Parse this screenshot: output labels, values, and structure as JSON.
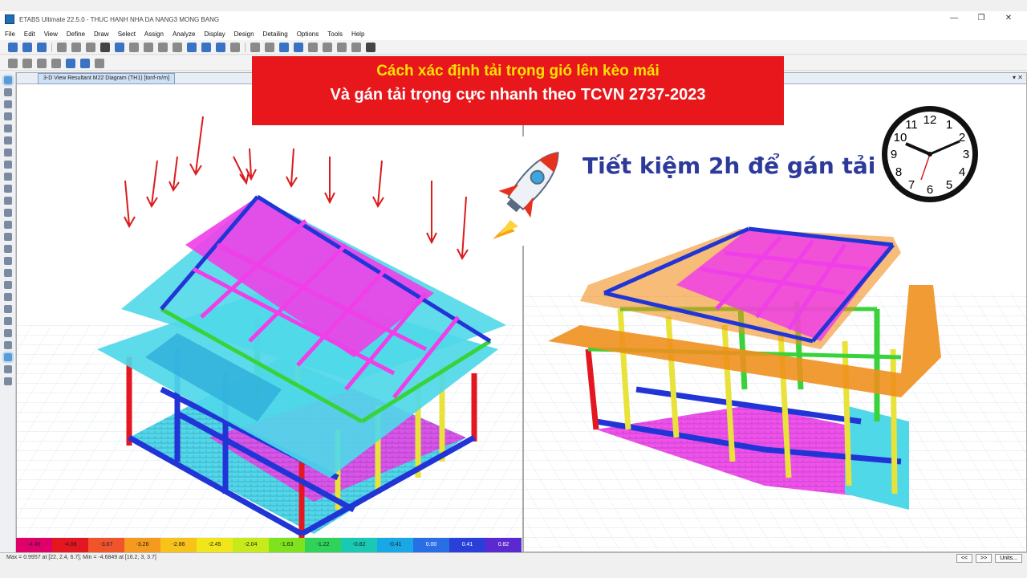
{
  "window": {
    "title": "ETABS Ultimate 22.5.0 - THUC HANH NHA DA NANG3 MONG BANG",
    "controls": [
      "—",
      "❐",
      "✕"
    ]
  },
  "menu": [
    "File",
    "Edit",
    "View",
    "Define",
    "Draw",
    "Select",
    "Assign",
    "Analyze",
    "Display",
    "Design",
    "Detailing",
    "Options",
    "Tools",
    "Help"
  ],
  "view_tab": "3-D View   Resultant M22 Diagram   (TH1)   [tonf-m/m]",
  "view_right_controls": "▾ ✕",
  "legend": {
    "values": [
      "-4.49",
      "-4.08",
      "-3.67",
      "-3.26",
      "-2.86",
      "-2.45",
      "-2.04",
      "-1.63",
      "-1.22",
      "-0.82",
      "-0.41",
      "0.00",
      "0.41",
      "0.82"
    ],
    "colors": [
      "#e0006a",
      "#e4161f",
      "#f0542a",
      "#f59a1e",
      "#f7c21a",
      "#f0e61a",
      "#c7ea1b",
      "#7fe21c",
      "#2fd35a",
      "#19c9b2",
      "#18a8e6",
      "#2a6ee6",
      "#2a3fd8",
      "#5a2ad0"
    ]
  },
  "status": {
    "text": "Max = 0.9957 at [22, 2.4, 6.7];  Min = -4.6849 at [16.2, 3, 3.7]",
    "buttons": [
      "<<",
      ">>",
      "Units..."
    ]
  },
  "banner": {
    "line1": "Cách xác định tải trọng gió lên kèo mái",
    "line2": "Và gán tải trọng cực nhanh theo TCVN 2737-2023"
  },
  "tagline": "Tiết kiệm 2h để gán tải",
  "clock": {
    "numbers": [
      "12",
      "1",
      "2",
      "3",
      "4",
      "5",
      "6",
      "7",
      "8",
      "9",
      "10",
      "11"
    ]
  },
  "colors": {
    "banner_bg": "#e7171c",
    "tagline": "#2d3a9a",
    "cyan_slab": "#4fd8e8",
    "magenta": "#f03ee8",
    "blue_beam": "#2135d6",
    "green_beam": "#38d33a",
    "yellow_col": "#e8e23a",
    "orange_roof": "#f0901e"
  }
}
